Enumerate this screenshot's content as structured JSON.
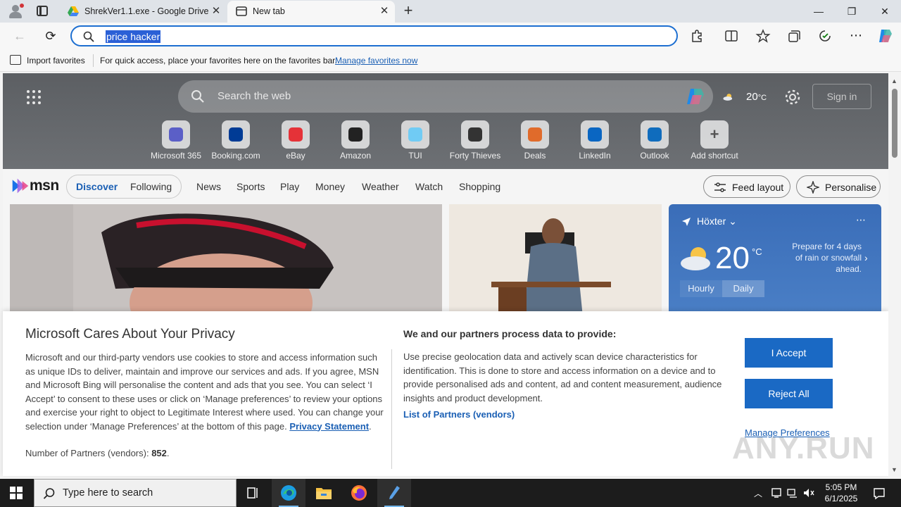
{
  "browser": {
    "tabs": [
      {
        "title": "ShrekVer1.1.exe - Google Drive"
      },
      {
        "title": "New tab"
      }
    ],
    "address_bar": {
      "value": "price hacker"
    },
    "favorites_bar": {
      "import_label": "Import favorites",
      "hint": "For quick access, place your favorites here on the favorites bar.",
      "manage_link": "Manage favorites now"
    }
  },
  "newtab": {
    "search_placeholder": "Search the web",
    "weather_temp": "20",
    "weather_unit": "°C",
    "sign_in_label": "Sign in",
    "shortcuts": [
      {
        "label": "Microsoft 365",
        "icon": "microsoft365-icon",
        "color": "#5b5fc7"
      },
      {
        "label": "Booking.com",
        "icon": "booking-icon",
        "color": "#003b95"
      },
      {
        "label": "eBay",
        "icon": "ebay-icon",
        "color": "#e53238"
      },
      {
        "label": "Amazon",
        "icon": "amazon-icon",
        "color": "#222222"
      },
      {
        "label": "TUI",
        "icon": "tui-icon",
        "color": "#70cbf4"
      },
      {
        "label": "Forty Thieves",
        "icon": "forty-thieves-icon",
        "color": "#333333"
      },
      {
        "label": "Deals",
        "icon": "deals-icon",
        "color": "#e06b2b"
      },
      {
        "label": "LinkedIn",
        "icon": "linkedin-icon",
        "color": "#0a66c2"
      },
      {
        "label": "Outlook",
        "icon": "outlook-icon",
        "color": "#0f6cbd"
      },
      {
        "label": "Add shortcut",
        "icon": "plus-icon",
        "color": "#555555"
      }
    ]
  },
  "msn": {
    "logo_text": "msn",
    "pills": [
      "Discover",
      "Following"
    ],
    "nav": [
      "News",
      "Sports",
      "Play",
      "Money",
      "Weather",
      "Watch",
      "Shopping"
    ],
    "feed_layout_label": "Feed layout",
    "personalise_label": "Personalise",
    "weather_card": {
      "location": "Höxter",
      "temp": "20",
      "unit": "°C",
      "hint": "Prepare for 4 days of rain or snowfall ahead.",
      "tabs": [
        "Hourly",
        "Daily"
      ]
    }
  },
  "privacy": {
    "title": "Microsoft Cares About Your Privacy",
    "body_pre": "Microsoft and our third-party vendors use cookies to store and access information such as unique IDs to deliver, maintain and improve our services and ads. If you agree, MSN and Microsoft Bing will personalise the content and ads that you see. You can select ‘I Accept’ to consent to these uses or click on ‘Manage preferences’ to review your options and exercise your right to object to Legitimate Interest where used.  You can change your selection under ‘Manage Preferences’ at the bottom of this page.",
    "privacy_link": "Privacy Statement",
    "partners_label": "Number of Partners (vendors):",
    "partners_count": "852",
    "purpose_title": "We and our partners process data to provide:",
    "purpose_body": "Use precise geolocation data and actively scan device characteristics for identification. This is done to store and access information on a device and to provide personalised ads and content, ad and content measurement, audience insights and product development.",
    "partners_link": "List of Partners (vendors)",
    "accept_label": "I Accept",
    "reject_label": "Reject All",
    "manage_label": "Manage Preferences",
    "watermark": "ANY.RUN"
  },
  "taskbar": {
    "search_placeholder": "Type here to search",
    "time": "5:05 PM",
    "date": "6/1/2025"
  }
}
